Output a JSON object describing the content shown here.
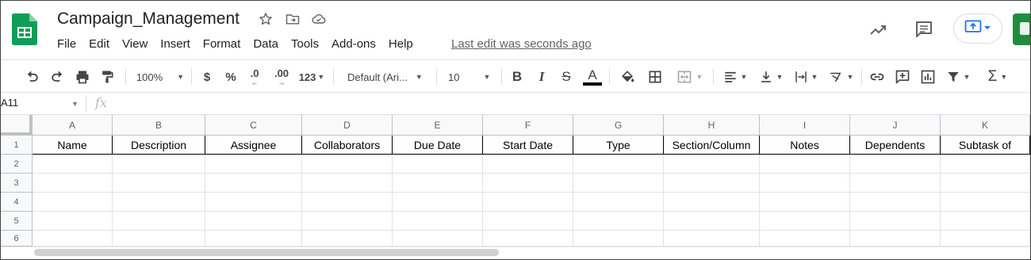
{
  "header": {
    "doc_title": "Campaign_Management",
    "last_edit": "Last edit was seconds ago",
    "menu": [
      "File",
      "Edit",
      "View",
      "Insert",
      "Format",
      "Data",
      "Tools",
      "Add-ons",
      "Help"
    ]
  },
  "toolbar": {
    "zoom": "100%",
    "currency": "$",
    "percent": "%",
    "dec_decrease": ".0",
    "dec_increase": ".00",
    "more_formats": "123",
    "font_family": "Default (Ari...",
    "font_size": "10",
    "bold": "B",
    "italic": "I",
    "strike": "S",
    "text_color": "A"
  },
  "formula_bar": {
    "name_box": "A11",
    "fx": "fx",
    "value": ""
  },
  "grid": {
    "columns": [
      "A",
      "B",
      "C",
      "D",
      "E",
      "F",
      "G",
      "H",
      "I",
      "J",
      "K"
    ],
    "rows": [
      "1",
      "2",
      "3",
      "4",
      "5",
      "6"
    ],
    "header_row": [
      "Name",
      "Description",
      "Assignee",
      "Collaborators",
      "Due Date",
      "Start Date",
      "Type",
      "Section/Column",
      "Notes",
      "Dependents",
      "Subtask of"
    ]
  },
  "colors": {
    "sheets_green": "#0f9d58",
    "present_blue": "#1a73e8",
    "share_green": "#1e8e3e"
  }
}
